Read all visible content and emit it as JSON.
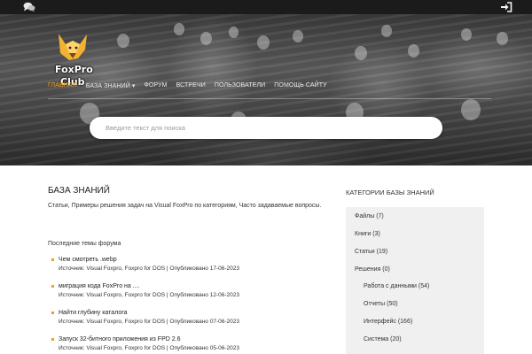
{
  "header": {
    "chat_icon": "chat-bubbles-icon",
    "login_icon": "sign-in-icon",
    "logo_line1": "FoxPro",
    "logo_line2": "Club"
  },
  "nav": {
    "items": [
      {
        "label": "Главная",
        "active": true
      },
      {
        "label": "База знаний ▾",
        "active": false
      },
      {
        "label": "Форум",
        "active": false
      },
      {
        "label": "Встречи",
        "active": false
      },
      {
        "label": "Пользователи",
        "active": false
      },
      {
        "label": "Помощь сайту",
        "active": false
      }
    ]
  },
  "search": {
    "placeholder": "Введите текст для поиска",
    "value": ""
  },
  "main": {
    "title": "База знаний",
    "desc_prefix": "Статьи, Примеры решения задач на ",
    "desc_link": "Visual FoxPro",
    "desc_suffix": " по категориям, Часто задаваемые вопросы.",
    "forum_title": "Последние темы форума",
    "topics": [
      {
        "title": "Чем смотреть .webp",
        "meta": "Источник: Visual Foxpro, Foxpro for DOS | Опубликовано 17-06-2023"
      },
      {
        "title": "миграция кода FoxPro на ....",
        "meta": "Источник: Visual Foxpro, Foxpro for DOS | Опубликовано 12-06-2023"
      },
      {
        "title": "Найти глубину каталога",
        "meta": "Источник: Visual Foxpro, Foxpro for DOS | Опубликовано 07-06-2023"
      },
      {
        "title": "Запуск 32-битного приложения из FPD 2.6",
        "meta": "Источник: Visual Foxpro, Foxpro for DOS | Опубликовано 05-06-2023"
      }
    ]
  },
  "sidebar": {
    "title": "Категории базы знаний",
    "categories": [
      {
        "label": "Файлы",
        "count": "(7)"
      },
      {
        "label": "Книги",
        "count": "(3)"
      },
      {
        "label": "Статьи",
        "count": "(19)"
      },
      {
        "label": "Решения",
        "count": "(0)"
      },
      {
        "label": "Работа с данными",
        "count": "(54)"
      },
      {
        "label": "Отчеты",
        "count": "(50)"
      },
      {
        "label": "Интерфейс",
        "count": "(166)"
      },
      {
        "label": "Система",
        "count": "(20)"
      }
    ]
  },
  "colors": {
    "accent": "#f0a020",
    "topbar": "#1b1b1b",
    "sidebar_bg": "#f0f0f0"
  }
}
